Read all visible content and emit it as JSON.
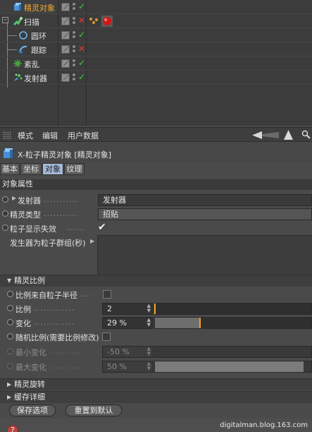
{
  "object_manager": {
    "objects": [
      {
        "name": "精灵对象",
        "selected": true,
        "vis_status": "ok",
        "icon": "particle-sprite-icon"
      },
      {
        "name": "扫描",
        "selected": false,
        "vis_status": "off",
        "icon": "sweep-icon"
      },
      {
        "name": "圆环",
        "selected": false,
        "vis_status": "ok",
        "icon": "circle-spline-icon"
      },
      {
        "name": "跟踪",
        "selected": false,
        "vis_status": "off",
        "icon": "tracer-icon"
      },
      {
        "name": "紊乱",
        "selected": false,
        "vis_status": "ok",
        "icon": "turbulence-icon"
      },
      {
        "name": "发射器",
        "selected": false,
        "vis_status": "ok",
        "icon": "emitter-icon"
      }
    ]
  },
  "attribute_manager": {
    "menu": [
      "模式",
      "编辑",
      "用户数据"
    ],
    "title": "X-粒子精灵对象 [精灵对象]",
    "tabs": [
      {
        "label": "基本",
        "active": false
      },
      {
        "label": "坐标",
        "active": false
      },
      {
        "label": "对象",
        "active": true
      },
      {
        "label": "纹理",
        "active": false
      }
    ],
    "section_title": "对象属性",
    "properties": {
      "emitter_label": "发射器",
      "emitter_value": "发射器",
      "sprite_type_label": "精灵类型",
      "sprite_type_value": "招贴",
      "particle_display_label": "粒子显示失效",
      "particle_display_checked": true,
      "emitter_group_label": "发生器为粒子群组(秒)"
    },
    "sprite_scale": {
      "header": "精灵比例",
      "from_radius_label": "比例来自粒子半径",
      "scale_label": "比例",
      "scale_value": "2",
      "scale_fraction": 0.0,
      "variation_label": "变化",
      "variation_value": "29 %",
      "variation_fraction": 0.29,
      "random_label": "随机比例(需要比例修改)",
      "min_label": "最小变化",
      "min_value": "-50 %",
      "min_fraction": 0.0,
      "max_label": "最大变化",
      "max_value": "50 %",
      "max_fraction": 0.95
    },
    "collapsed_groups": [
      "精灵旋转",
      "缓存详细"
    ],
    "buttons": {
      "save": "保存选项",
      "reset": "重置到默认"
    }
  },
  "status_bar": {
    "watermark": "digitalman.blog.163.com"
  },
  "colors": {
    "selected_object": "#f7a92a",
    "status_ok": "#3fd03f",
    "status_off": "#e23b3b",
    "slider_knob": "#f2a11f",
    "active_tab": "#a4b8d8"
  }
}
